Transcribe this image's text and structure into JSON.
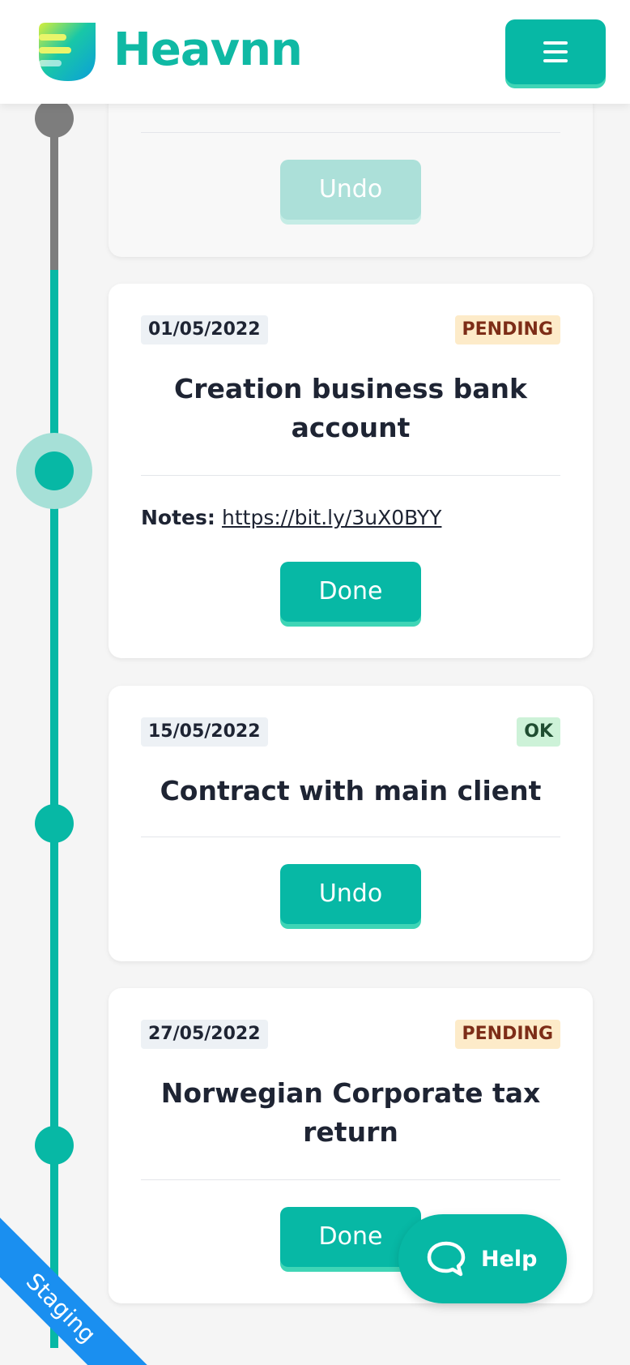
{
  "app": {
    "brand": "Heavnn",
    "colors": {
      "accent": "#07b8a5",
      "accent_light": "#3fd5b6",
      "pending_bg": "#fdebc9",
      "ok_bg": "#cdf2d8",
      "ribbon": "#1a8ff0"
    }
  },
  "header": {
    "menu_icon": "hamburger-icon"
  },
  "cards": [
    {
      "button_label": "Undo",
      "button_state": "disabled"
    },
    {
      "date": "01/05/2022",
      "status": "PENDING",
      "title": "Creation business bank account",
      "notes_label": "Notes:",
      "notes_link": "https://bit.ly/3uX0BYY",
      "button_label": "Done"
    },
    {
      "date": "15/05/2022",
      "status": "OK",
      "title": "Contract with main client",
      "button_label": "Undo"
    },
    {
      "date": "27/05/2022",
      "status": "PENDING",
      "title": "Norwegian Corporate tax return",
      "button_label": "Done"
    }
  ],
  "help": {
    "label": "Help",
    "icon": "chat-bubble-icon"
  },
  "environment_ribbon": "Staging"
}
